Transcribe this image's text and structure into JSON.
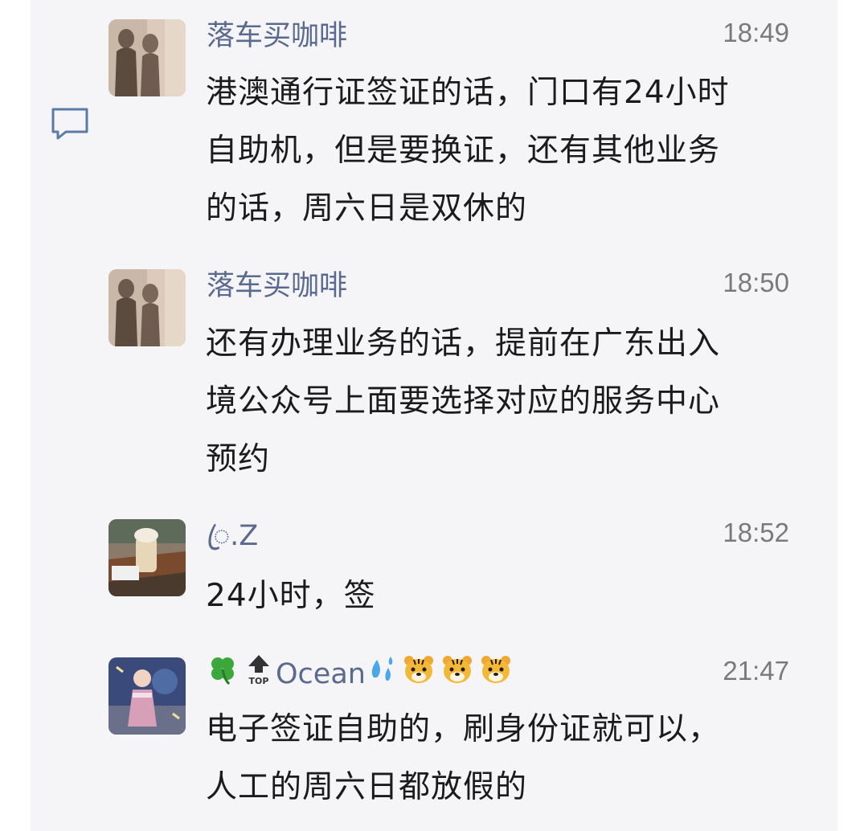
{
  "messages": [
    {
      "name": "落车买咖啡",
      "time": "18:49",
      "lines": [
        "港澳通行证签证的话，门口有24小时",
        "自助机，但是要换证，还有其他业务",
        "的话，周六日是双休的"
      ]
    },
    {
      "name": "落车买咖啡",
      "time": "18:50",
      "lines": [
        "还有办理业务的话，提前在广东出入",
        "境公众号上面要选择对应的服务中心",
        "预约"
      ]
    },
    {
      "name": "ꦿ.Z",
      "time": "18:52",
      "lines": [
        "24小时，签"
      ]
    },
    {
      "name": "Ocean",
      "name_emoji": [
        "four-leaf-clover-emoji",
        "top-arrow-emoji",
        "sweat-droplets-emoji",
        "tiger-face-emoji",
        "tiger-face-emoji",
        "tiger-face-emoji"
      ],
      "time": "21:47",
      "lines": [
        "电子签证自助的，刷身份证就可以，",
        "人工的周六日都放假的"
      ]
    }
  ],
  "colors": {
    "panel_bg": "#f5f5f7",
    "name": "#5a6a8e",
    "time": "#7a7a7a",
    "text": "#1b1b1b"
  }
}
